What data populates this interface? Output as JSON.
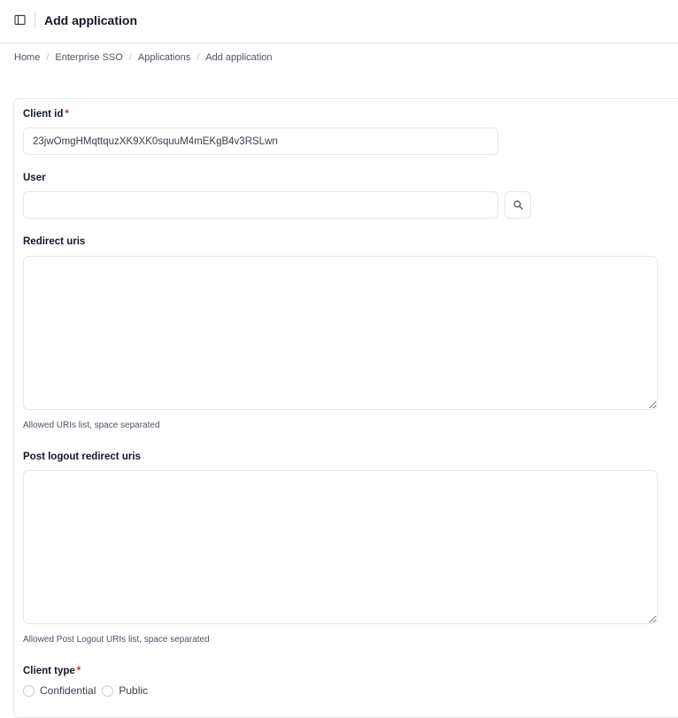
{
  "header": {
    "title": "Add application",
    "sidebar_toggle_icon": "sidebar-panel-icon"
  },
  "breadcrumb": {
    "items": [
      "Home",
      "Enterprise SSO",
      "Applications"
    ],
    "current": "Add application"
  },
  "form": {
    "client_id": {
      "label": "Client id",
      "required_mark": "*",
      "value": "23jwOmgHMqttquzXK9XK0squuM4mEKgB4v3RSLwn"
    },
    "user": {
      "label": "User",
      "value": "",
      "search_icon": "search-icon"
    },
    "redirect_uris": {
      "label": "Redirect uris",
      "value": "",
      "help": "Allowed URIs list, space separated"
    },
    "post_logout_redirect_uris": {
      "label": "Post logout redirect uris",
      "value": "",
      "help": "Allowed Post Logout URIs list, space separated"
    },
    "client_type": {
      "label": "Client type",
      "required_mark": "*",
      "options": [
        "Confidential",
        "Public"
      ]
    }
  }
}
